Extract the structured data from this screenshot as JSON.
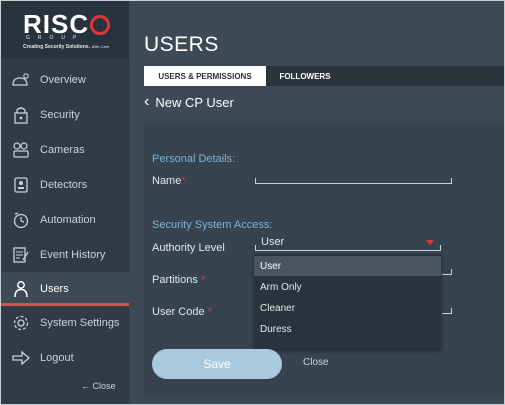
{
  "brand": {
    "name": "RISC",
    "group": "GROUP",
    "tagline": "Creating Security Solutions.",
    "tagline_sub": "With Care."
  },
  "sidebar": {
    "items": [
      {
        "label": "Overview",
        "icon": "overview-icon"
      },
      {
        "label": "Security",
        "icon": "lock-icon"
      },
      {
        "label": "Cameras",
        "icon": "camera-icon"
      },
      {
        "label": "Detectors",
        "icon": "detector-icon"
      },
      {
        "label": "Automation",
        "icon": "automation-icon"
      },
      {
        "label": "Event History",
        "icon": "event-history-icon"
      },
      {
        "label": "Users",
        "icon": "user-icon",
        "active": true
      },
      {
        "label": "System Settings",
        "icon": "gear-icon"
      },
      {
        "label": "Logout",
        "icon": "logout-icon"
      }
    ],
    "collapse_label": "← Close"
  },
  "page": {
    "title": "USERS",
    "tabs": [
      {
        "label": "USERS & PERMISSIONS",
        "active": true
      },
      {
        "label": "FOLLOWERS",
        "active": false
      }
    ],
    "back_label": "New CP User"
  },
  "form": {
    "personal_heading": "Personal Details:",
    "name_label": "Name",
    "access_heading": "Security System Access:",
    "authority_label": "Authority Level",
    "authority_value": "User",
    "partitions_label": "Partitions",
    "user_code_label": "User Code",
    "required_mark": "*",
    "dropdown_options": [
      "User",
      "Arm Only",
      "Cleaner",
      "Duress"
    ],
    "dropdown_selected": "User",
    "save_label": "Save",
    "close_label": "Close"
  },
  "colors": {
    "sidebar_bg": "#303b46",
    "main_bg": "#3d4a56",
    "accent_red": "#e0353b",
    "save_button": "#a9c9de",
    "section_heading": "#7fb2cf"
  }
}
